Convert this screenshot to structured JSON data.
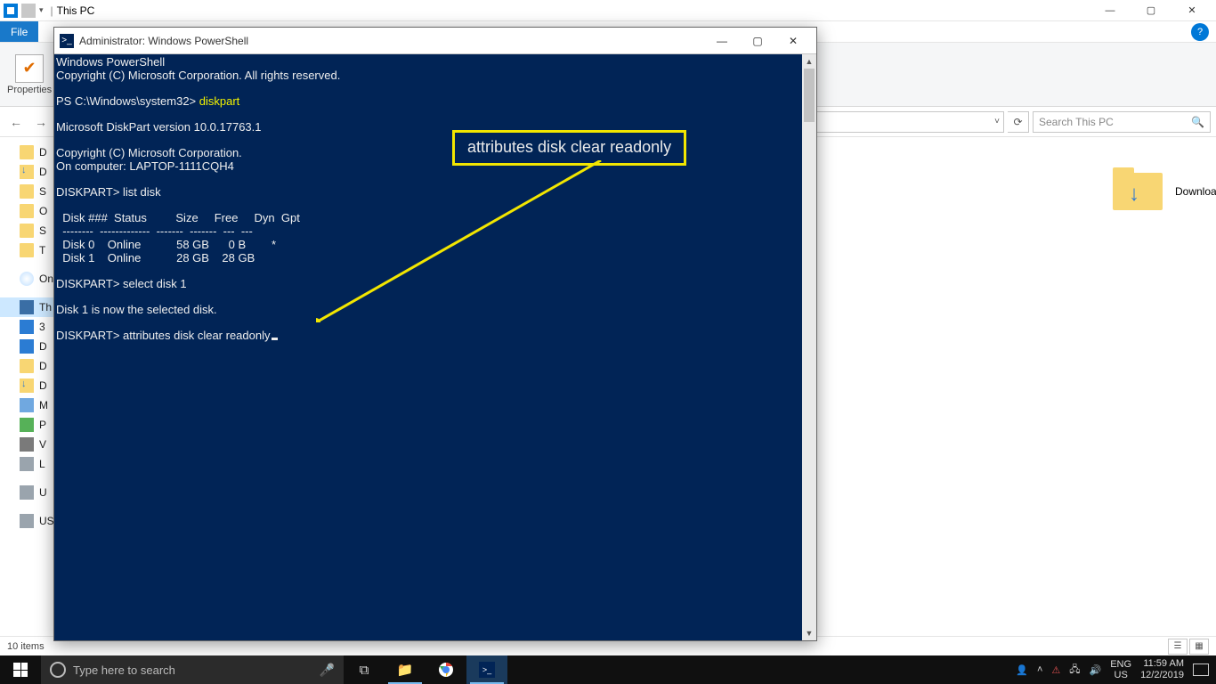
{
  "explorer": {
    "title": "This PC",
    "tabs": {
      "file": "File"
    },
    "ribbon": {
      "properties": "Properties"
    },
    "nav": {
      "back": "←",
      "fwd": "→",
      "up": "↑",
      "refresh": "⟳"
    },
    "search_placeholder": "Search This PC",
    "tree": {
      "d1": "D",
      "d2": "D",
      "s1": "S",
      "o1": "O",
      "s2": "S",
      "t1": "T",
      "onedrive": "On",
      "thispc": "Th",
      "obj": "3",
      "desk": "D",
      "docs": "D",
      "down": "D",
      "mus": "M",
      "pic": "P",
      "vid": "V",
      "loc": "L",
      "u1": "U",
      "usb": "US"
    },
    "content": {
      "downloads": "Downloads"
    },
    "status": {
      "items": "10 items"
    }
  },
  "powershell": {
    "title": "Administrator: Windows PowerShell",
    "lines": {
      "l1": "Windows PowerShell",
      "l2": "Copyright (C) Microsoft Corporation. All rights reserved.",
      "l3a": "PS C:\\Windows\\system32> ",
      "l3b": "diskpart",
      "l4": "Microsoft DiskPart version 10.0.17763.1",
      "l5": "Copyright (C) Microsoft Corporation.",
      "l6": "On computer: LAPTOP-1111CQH4",
      "l7": "DISKPART> list disk",
      "l8": "  Disk ###  Status         Size     Free     Dyn  Gpt",
      "l9": "  --------  -------------  -------  -------  ---  ---",
      "l10": "  Disk 0    Online           58 GB      0 B        *",
      "l11": "  Disk 1    Online           28 GB    28 GB",
      "l12": "DISKPART> select disk 1",
      "l13": "Disk 1 is now the selected disk.",
      "l14": "DISKPART> attributes disk clear readonly"
    },
    "callout": "attributes disk clear readonly"
  },
  "taskbar": {
    "search_placeholder": "Type here to search",
    "lang1": "ENG",
    "lang2": "US",
    "time": "11:59 AM",
    "date": "12/2/2019"
  }
}
